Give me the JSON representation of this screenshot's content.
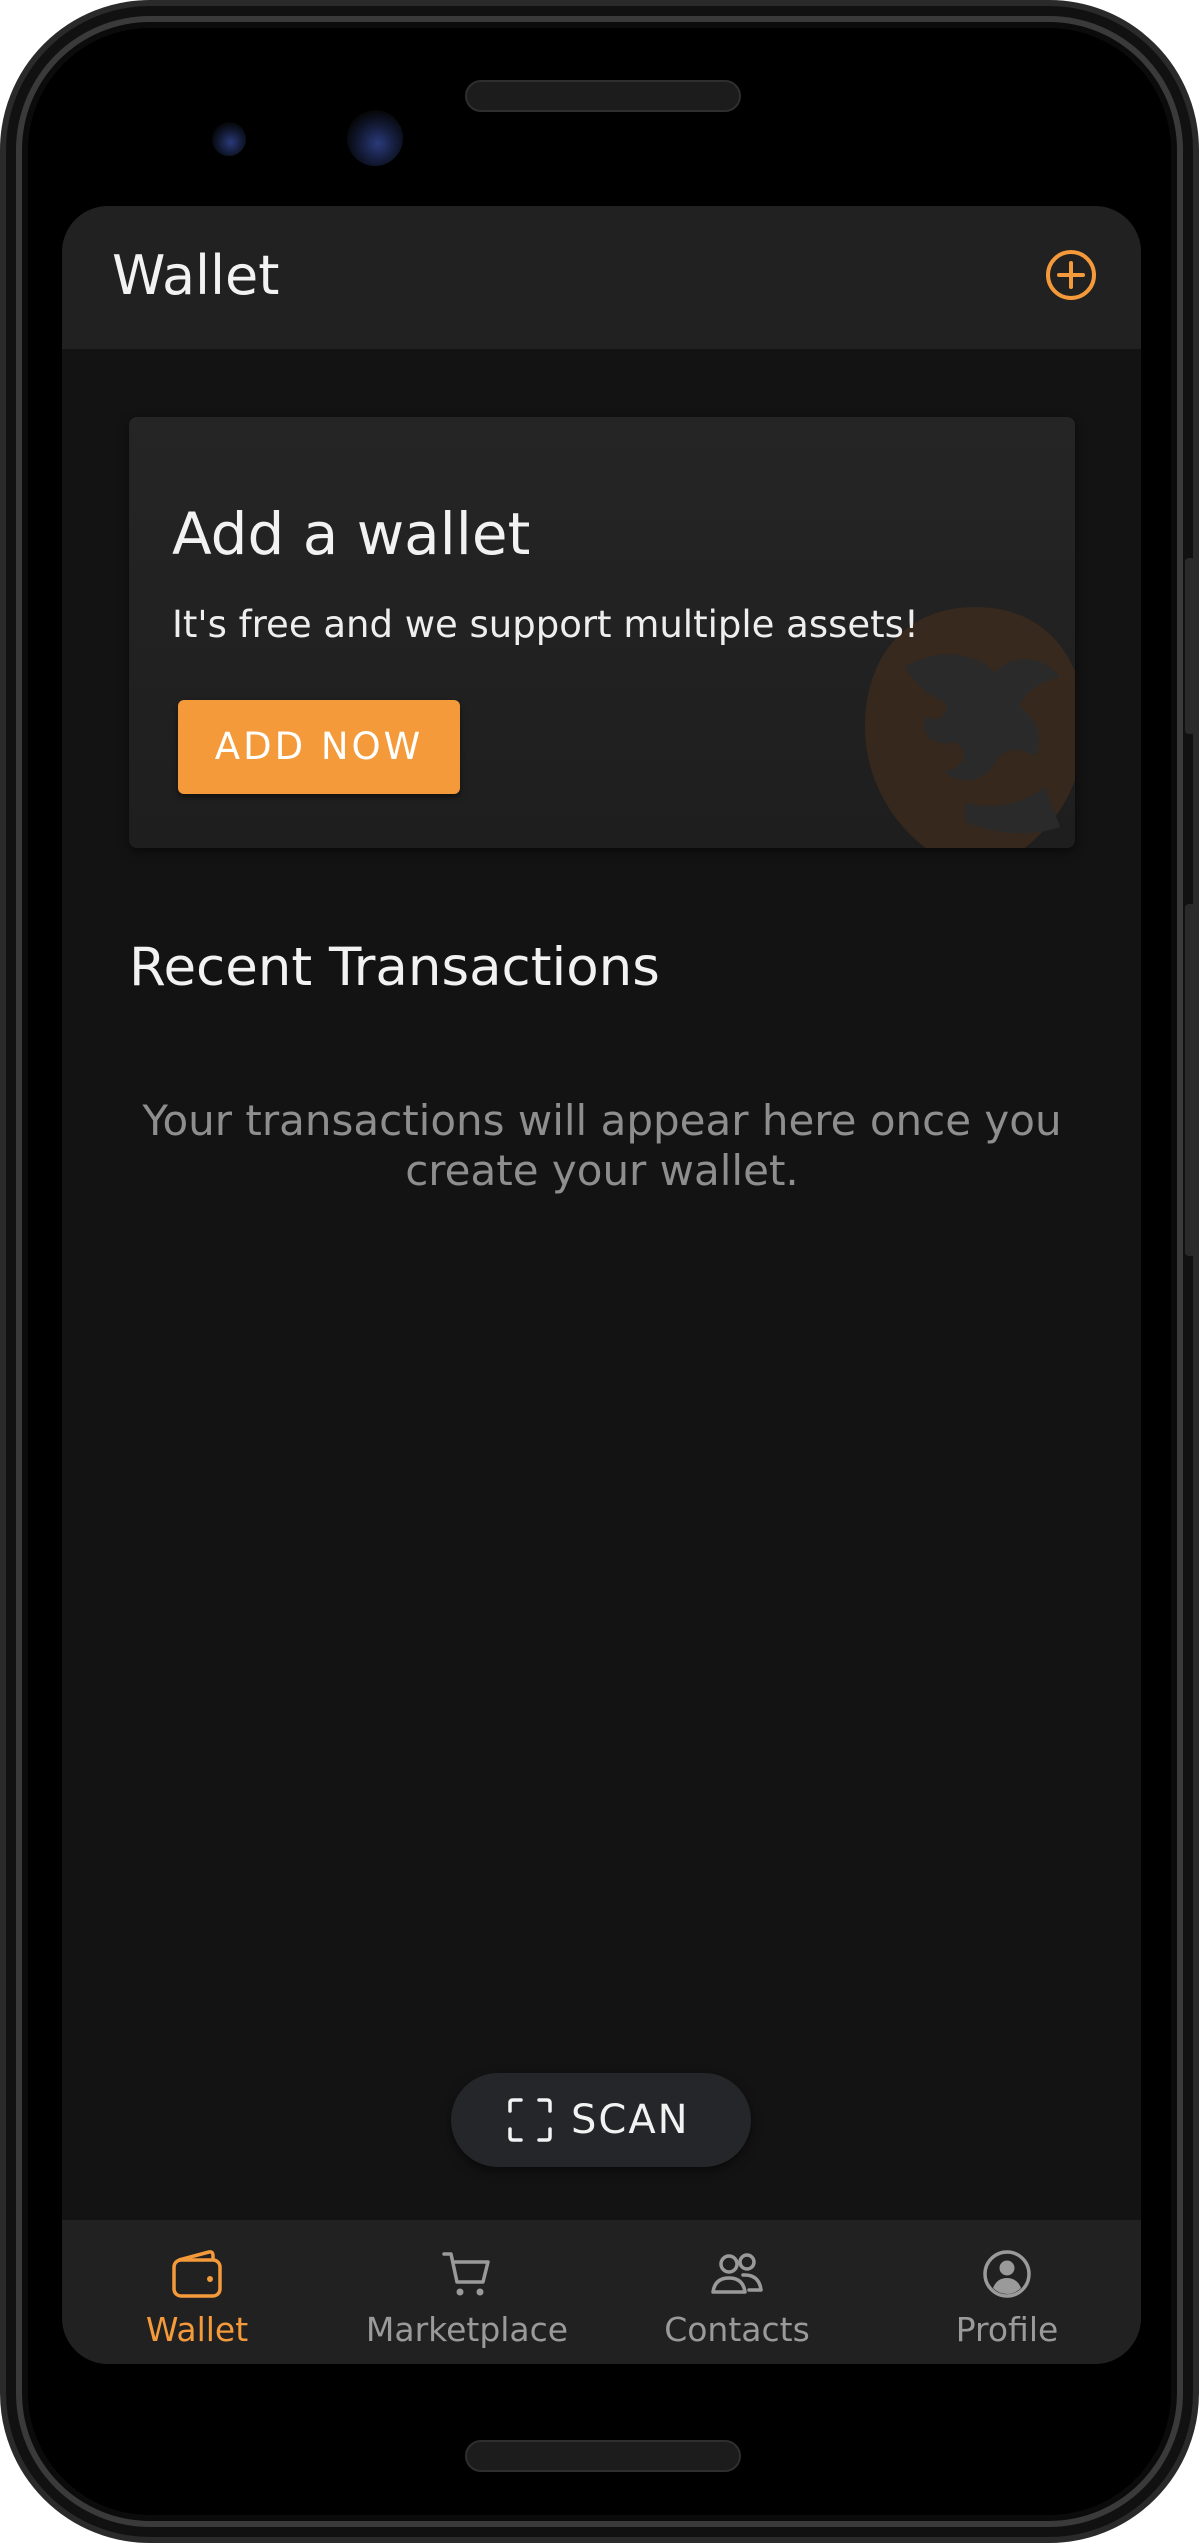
{
  "colors": {
    "accent": "#f49a3a",
    "background": "#131313",
    "bar": "#212121",
    "muted_text": "#8e8e8e"
  },
  "header": {
    "title": "Wallet",
    "action_icon": "add-circle-icon"
  },
  "promo": {
    "title": "Add a wallet",
    "subtitle": "It's free and we support multiple assets!",
    "button_label": "ADD NOW"
  },
  "transactions": {
    "title": "Recent Transactions",
    "empty_message": "Your transactions will appear here once you create your wallet."
  },
  "scan": {
    "label": "SCAN",
    "icon": "scan-frame-icon"
  },
  "bottom_nav": {
    "items": [
      {
        "label": "Wallet",
        "icon": "wallet-icon",
        "active": true
      },
      {
        "label": "Marketplace",
        "icon": "cart-icon",
        "active": false
      },
      {
        "label": "Contacts",
        "icon": "contacts-icon",
        "active": false
      },
      {
        "label": "Profile",
        "icon": "profile-icon",
        "active": false
      }
    ]
  }
}
